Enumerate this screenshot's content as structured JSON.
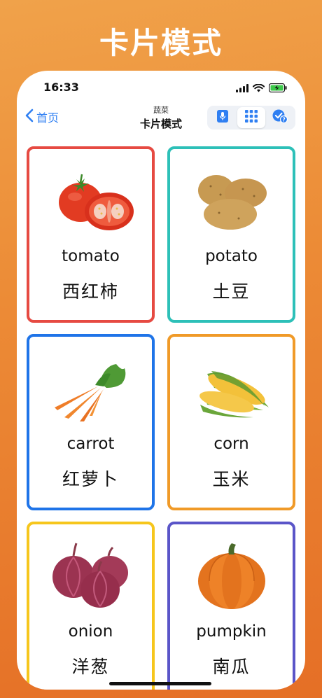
{
  "promo_title": "卡片模式",
  "status": {
    "time": "16:33"
  },
  "nav": {
    "back_label": "首页",
    "subtitle": "蔬菜",
    "title": "卡片模式"
  },
  "colors": {
    "accent": "#2f7ff2",
    "red": "#e64a42",
    "teal": "#2dc0b8",
    "blue": "#1f74e8",
    "orange": "#f09a28",
    "yellow": "#f6c61c",
    "indigo": "#5a55c8"
  },
  "cards": [
    {
      "en": "tomato",
      "zh": "西红柿",
      "icon": "tomato-image"
    },
    {
      "en": "potato",
      "zh": "土豆",
      "icon": "potato-image"
    },
    {
      "en": "carrot",
      "zh": "红萝卜",
      "icon": "carrot-image"
    },
    {
      "en": "corn",
      "zh": "玉米",
      "icon": "corn-image"
    },
    {
      "en": "onion",
      "zh": "洋葱",
      "icon": "onion-image"
    },
    {
      "en": "pumpkin",
      "zh": "南瓜",
      "icon": "pumpkin-image"
    }
  ]
}
